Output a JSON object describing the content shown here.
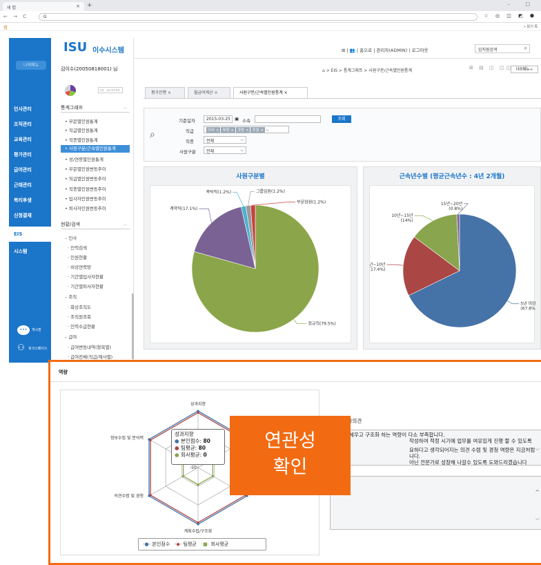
{
  "browser": {
    "tab_title": "새 탭",
    "tab_close": "×",
    "new_tab": "+",
    "window_controls": "– □",
    "nav_buttons": "← → C",
    "address": "G",
    "ext_icons": "☆ ◎ ◫ ◩ ⬢",
    "apps": "앱",
    "other_bookmarks": "» 읽기 목"
  },
  "leftnav": {
    "my_menu": "나의메뉴",
    "items": [
      {
        "label": "인사관리"
      },
      {
        "label": "조직관리"
      },
      {
        "label": "교육관리"
      },
      {
        "label": "평가관리"
      },
      {
        "label": "급여관리"
      },
      {
        "label": "근태관리"
      },
      {
        "label": "복리후생"
      },
      {
        "label": "신청결재"
      },
      {
        "label": "EIS"
      },
      {
        "label": "시스템"
      }
    ],
    "notice_label": "게시판",
    "org_label": "워크스페이스"
  },
  "panel2": {
    "logo_text": "ISU",
    "logo_korean": "이수시스템",
    "user_name": "김이수(20050818001) 님",
    "view_buttons": "▭ ▭▭▭",
    "section1_title": "통계그래프",
    "section1_items": [
      "• 부문별인원통계",
      "• 직급별인원통계",
      "• 직종별인원통계",
      "• 사원구분/근속별인원통계",
      "• 성/연령별인원통계",
      "• 부문별인원변동추이",
      "• 직급별인원변동추이",
      "• 직종별인원변동추이",
      "• 입사자인원변동추이",
      "• 퇴사자인원변동추이"
    ],
    "section2_title": "현황/검색",
    "section2_items": [
      "– 인사",
      "· 인력검색",
      "· 인원현황",
      "· 비상연락망",
      "· 기간별입사자현황",
      "· 기간별퇴사자현황",
      "– 조직",
      "· 화상조직도",
      "· 조직원조회",
      "· 인력수급현황",
      "– 급여",
      "· 급여변동내역(항목별)",
      "· 급여전체(직급/재사별)"
    ]
  },
  "main": {
    "top_links": "⊞ | 👥 | 홈으로 | 관리자(ADMIN) | 로그아웃",
    "search_placeholder": "임직원검색",
    "breadcrumb": "⌂ > EIS > 통계그래프 > 사원구분/근속별인원통계",
    "view_icons": "⊠ ▤ ◫ ◫◫ ◫◫",
    "my_menu_plus": "나의메뉴+",
    "tabs": [
      {
        "label": "평가진행  ×"
      },
      {
        "label": "월급여계산  ×"
      },
      {
        "label": "사원구분/근속별인원통계  ×"
      }
    ],
    "filter": {
      "base_date_label": "기준일자",
      "base_date_value": "2015-03-25",
      "calendar_icon": "▣",
      "dept_label": "소속",
      "query_button": "조회",
      "grade_label": "직급",
      "grade_chips": [
        "이사 ×",
        "부장 ×",
        "과장 ×",
        "주임 ×"
      ],
      "jobtype_label": "직종",
      "jobtype_value": "전체",
      "emptype_label": "사원구분",
      "emptype_value": "전체"
    }
  },
  "chart_data": [
    {
      "type": "pie",
      "title": "사원구분별",
      "categories": [
        "정규직",
        "계약직",
        "촉탁직",
        "그룹임원",
        "부문임원"
      ],
      "values": [
        79.5,
        17.1,
        1.2,
        1.2,
        1.2
      ],
      "labels": [
        "정규직(79.5%)",
        "계약직(17.1%)",
        "촉탁직(1.2%)",
        "그룹임원(1.2%)",
        "부문임원(1.2%)"
      ],
      "colors": [
        "#8ba64a",
        "#7b6295",
        "#4cb1d2",
        "#9a9a9a",
        "#c7423f"
      ]
    },
    {
      "type": "pie",
      "title": "근속년수별 (평균근속년수 : 4년 2개월)",
      "categories": [
        "5년 미만",
        "5년~10년",
        "10년~15년",
        "15년~20년"
      ],
      "values": [
        67.8,
        17.4,
        14,
        0.8
      ],
      "labels": [
        "5년 미만\n(67.8%)",
        "5년~10년\n(17.4%)",
        "10년~15년\n(14%)",
        "15년~20년\n(0.8%)"
      ],
      "colors": [
        "#4572a7",
        "#aa4643",
        "#89a54e",
        "#80699b"
      ]
    },
    {
      "type": "radar",
      "axes": [
        "성과지향",
        "정보수집 및 분석력",
        "의견수렴 및 경청",
        "계획수립/구조화"
      ],
      "tick_label": "-50",
      "series": [
        {
          "name": "본인점수",
          "color": "#4572a7"
        },
        {
          "name": "팀평균",
          "color": "#aa4643"
        },
        {
          "name": "회사평균",
          "color": "#89a54e"
        }
      ],
      "tooltip": {
        "title": "성과지향",
        "rows": [
          {
            "name": "본인점수",
            "value": "80"
          },
          {
            "name": "팀평균",
            "value": "80"
          },
          {
            "name": "회사평균",
            "value": "0"
          }
        ]
      }
    }
  ],
  "overlay": {
    "title": "역량",
    "legend": [
      "본인점수",
      "팀평균",
      "회사평균"
    ],
    "eval_title": "1차평가자의견",
    "eval_lines": [
      "계획을 세우고 구조화 하는 역량이 다소 부족합니다.",
      "작성하여 적정 시기에 업무를 여유있게 진행 할 수 있도록",
      "요하다고 생각되어지는 의견 수렴 및 경청 역량은 지금처럼",
      "니다.",
      "아닌 전문가로 성장해 나갈수 있도록 도와드리겠습니다"
    ],
    "badge_line1": "연관성",
    "badge_line2": "확인"
  }
}
